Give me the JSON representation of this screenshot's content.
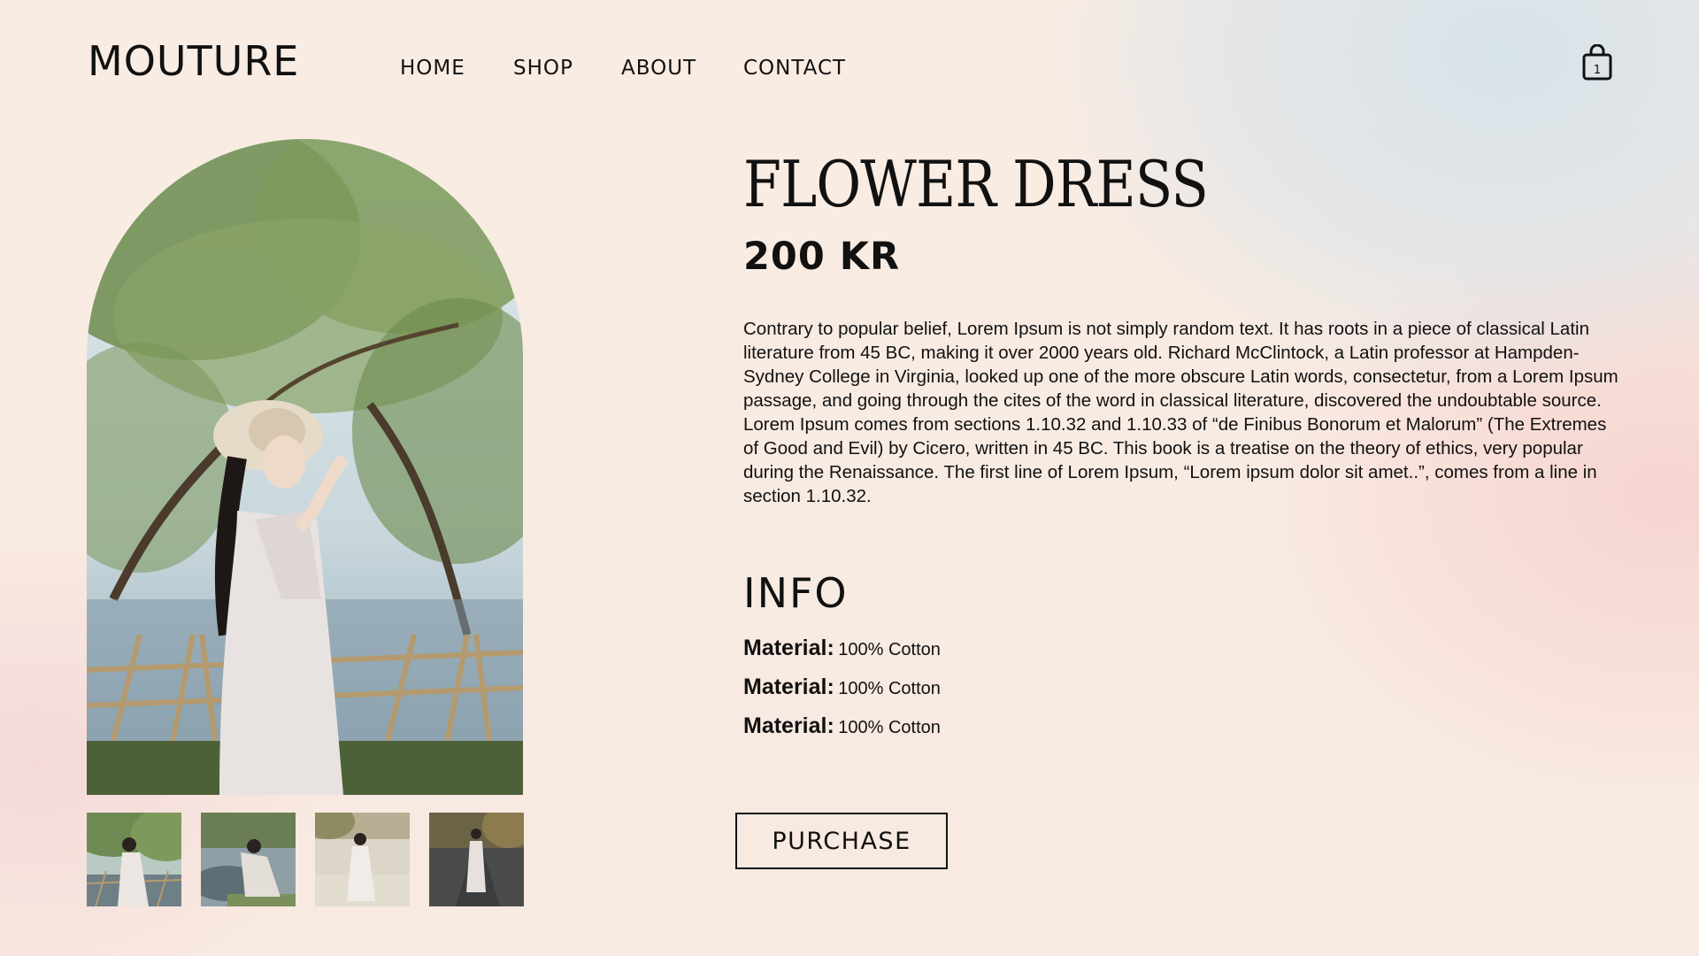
{
  "header": {
    "logo": "MOUTURE",
    "nav": [
      {
        "label": "HOME"
      },
      {
        "label": "SHOP"
      },
      {
        "label": "ABOUT"
      },
      {
        "label": "CONTACT"
      }
    ],
    "cart_count": "1",
    "cart_icon": "shopping-bag-icon"
  },
  "product": {
    "title": "FLOWER DRESS",
    "price": "200 KR",
    "description": "Contrary to popular belief, Lorem Ipsum is not simply random text. It has roots in a piece of classical Latin literature from 45 BC, making it over 2000 years old. Richard McClintock, a Latin professor at Hampden-Sydney College in Virginia, looked up one of the more obscure Latin words, consectetur, from a Lorem Ipsum passage, and going through the cites of the word in classical literature, discovered the undoubtable source. Lorem Ipsum comes from sections 1.10.32 and 1.10.33 of “de Finibus Bonorum et Malorum” (The Extremes of Good and Evil) by Cicero, written in 45 BC. This book is a treatise on the theory of ethics, very popular during the Renaissance. The first line of Lorem Ipsum, “Lorem ipsum dolor sit amet..”, comes from a line in section 1.10.32.",
    "info_heading": "INFO",
    "info": [
      {
        "label": "Material:",
        "value": "100% Cotton"
      },
      {
        "label": "Material:",
        "value": "100% Cotton"
      },
      {
        "label": "Material:",
        "value": "100% Cotton"
      }
    ],
    "purchase_label": "PURCHASE"
  },
  "colors": {
    "text": "#111111",
    "background": "#f8ebe2",
    "accent_blue": "#d6e2ea",
    "accent_pink": "#f6d2ce"
  }
}
